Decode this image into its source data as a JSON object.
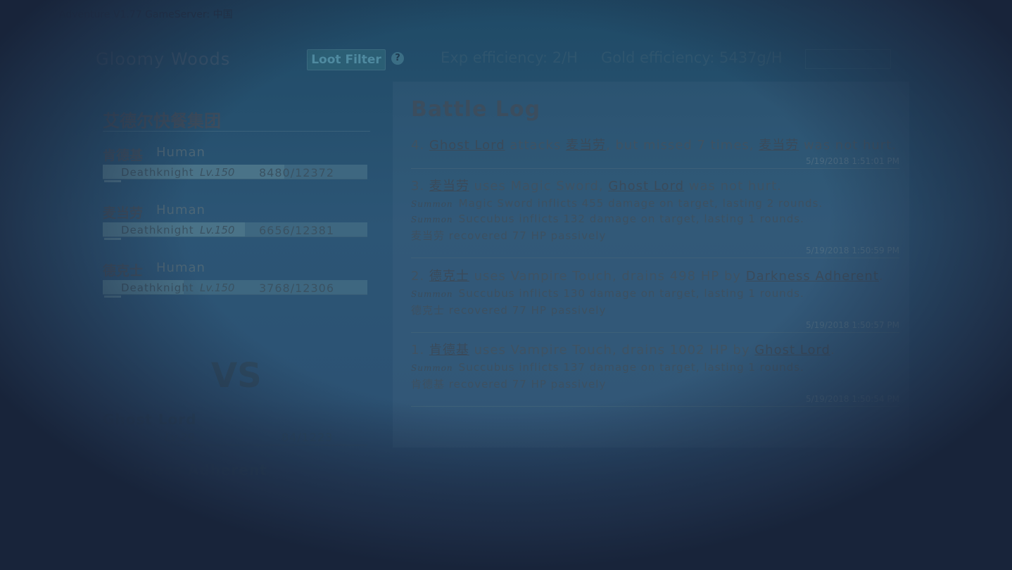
{
  "app": {
    "title": "Adventure V1.77 GameServer: 中国"
  },
  "header": {
    "zone": "Gloomy Woods",
    "loot_filter": "Loot Filter",
    "help": "?",
    "exp_efficiency": "Exp efficiency: 2/H",
    "gold_efficiency": "Gold efficiency: 5437g/H"
  },
  "party": {
    "name": "艾德尔快餐集团",
    "members": [
      {
        "name": "肯德基",
        "race": "Human",
        "class": "Deathknight",
        "level": "Lv.150",
        "hp": "8480/12372",
        "hp_fraction": 0.685
      },
      {
        "name": "麦当劳",
        "race": "Human",
        "class": "Deathknight",
        "level": "Lv.150",
        "hp": "6656/12381",
        "hp_fraction": 0.538
      },
      {
        "name": "德克士",
        "race": "Human",
        "class": "Deathknight",
        "level": "Lv.150",
        "hp": "3768/12306",
        "hp_fraction": 0.306
      }
    ]
  },
  "vs": "VS",
  "enemies": [
    {
      "name": "Ghost Lord",
      "level": "Lv.29",
      "hp": "84/1223"
    },
    {
      "name": "Darkness Adherent",
      "level": "",
      "hp": ""
    }
  ],
  "battle_log": {
    "title": "Battle Log",
    "entries": [
      {
        "main": [
          "4. ",
          "Ghost Lord",
          " attacks ",
          "麦当劳",
          ", but missed 7 times, ",
          "麦当劳",
          " was not hurt."
        ],
        "subs": [],
        "timestamp": "5/19/2018 1:51:01 PM"
      },
      {
        "main": [
          "3. ",
          "麦当劳",
          " uses Magic Sword, ",
          "Ghost Lord",
          " was not hurt."
        ],
        "subs": [
          {
            "tag": "Summon",
            "text": "Magic Sword inflicts 455 damage on target, lasting 2 rounds."
          },
          {
            "tag": "Summon",
            "text": "Succubus inflicts 132 damage on target, lasting 1 rounds."
          },
          {
            "tag": "",
            "text": "麦当劳 recovered 77 HP passively"
          }
        ],
        "timestamp": "5/19/2018 1:50:59 PM"
      },
      {
        "main": [
          "2. ",
          "德克士",
          " uses Vampire Touch, drains 498 HP by ",
          "Darkness Adherent",
          "."
        ],
        "subs": [
          {
            "tag": "Summon",
            "text": "Succubus inflicts 130 damage on target, lasting 1 rounds."
          },
          {
            "tag": "",
            "text": "德克士 recovered 77 HP passively"
          }
        ],
        "timestamp": "5/19/2018 1:50:57 PM"
      },
      {
        "main": [
          "1. ",
          "肯德基",
          " uses Vampire Touch, drains 1002 HP by ",
          "Ghost Lord",
          "."
        ],
        "subs": [
          {
            "tag": "Summon",
            "text": "Succubus inflicts 137 damage on target, lasting 1 rounds."
          },
          {
            "tag": "",
            "text": "肯德基 recovered 77 HP passively"
          }
        ],
        "timestamp": "5/19/2018 1:50:54 PM"
      }
    ]
  }
}
